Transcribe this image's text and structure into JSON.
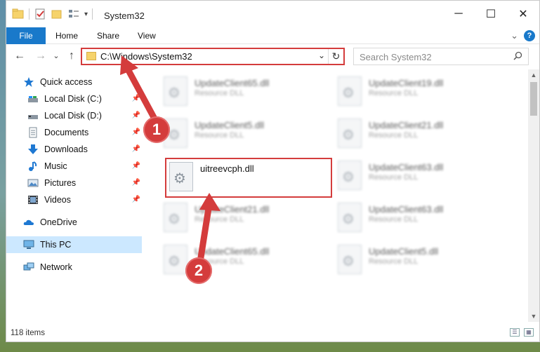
{
  "window": {
    "title": "System32",
    "controls": {
      "minimize": "─",
      "maximize": "☐",
      "close": "✕"
    }
  },
  "ribbon": {
    "tabs": [
      "File",
      "Home",
      "Share",
      "View"
    ],
    "expand_chevron": "⌄",
    "help": "?"
  },
  "navigation": {
    "back": "←",
    "forward": "→",
    "recent": "⌄",
    "up": "↑"
  },
  "address": {
    "path": "C:\\Windows\\System32",
    "dropdown": "⌄",
    "refresh": "↻"
  },
  "search": {
    "placeholder": "Search System32",
    "icon": "search-icon"
  },
  "sidebar": {
    "items": [
      {
        "label": "Quick access",
        "icon": "star-icon",
        "pinned": false
      },
      {
        "label": "Local Disk (C:)",
        "icon": "drive-icon",
        "pinned": true
      },
      {
        "label": "Local Disk (D:)",
        "icon": "drive-icon",
        "pinned": true
      },
      {
        "label": "Documents",
        "icon": "document-icon",
        "pinned": true
      },
      {
        "label": "Downloads",
        "icon": "download-icon",
        "pinned": true
      },
      {
        "label": "Music",
        "icon": "music-icon",
        "pinned": true
      },
      {
        "label": "Pictures",
        "icon": "pictures-icon",
        "pinned": true
      },
      {
        "label": "Videos",
        "icon": "videos-icon",
        "pinned": true
      },
      {
        "label": "OneDrive",
        "icon": "cloud-icon",
        "pinned": false
      },
      {
        "label": "This PC",
        "icon": "computer-icon",
        "pinned": false,
        "selected": true
      },
      {
        "label": "Network",
        "icon": "network-icon",
        "pinned": false
      }
    ]
  },
  "files": [
    {
      "name": "UpdateClient65.dll",
      "type": "Resource DLL",
      "blurred": true
    },
    {
      "name": "UpdateClient19.dll",
      "type": "Resource DLL",
      "blurred": true
    },
    {
      "name": "UpdateClient5.dll",
      "type": "Resource DLL",
      "blurred": true
    },
    {
      "name": "UpdateClient21.dll",
      "type": "Resource DLL",
      "blurred": true
    },
    {
      "name": "uitreevcph.dll",
      "type": "",
      "blurred": false
    },
    {
      "name": "UpdateClient63.dll",
      "type": "Resource DLL",
      "blurred": true
    },
    {
      "name": "UpdateClient21.dll",
      "type": "Resource DLL",
      "blurred": true
    },
    {
      "name": "UpdateClient63.dll",
      "type": "Resource DLL",
      "blurred": true
    },
    {
      "name": "UpdateClient65.dll",
      "type": "Resource DLL",
      "blurred": true
    },
    {
      "name": "UpdateClient5.dll",
      "type": "Resource DLL",
      "blurred": true
    }
  ],
  "status": {
    "item_count": "118 items"
  },
  "callouts": [
    "1",
    "2"
  ],
  "colors": {
    "accent": "#1979ca",
    "highlight": "#d43c3c",
    "selected_bg": "#cce8ff"
  }
}
